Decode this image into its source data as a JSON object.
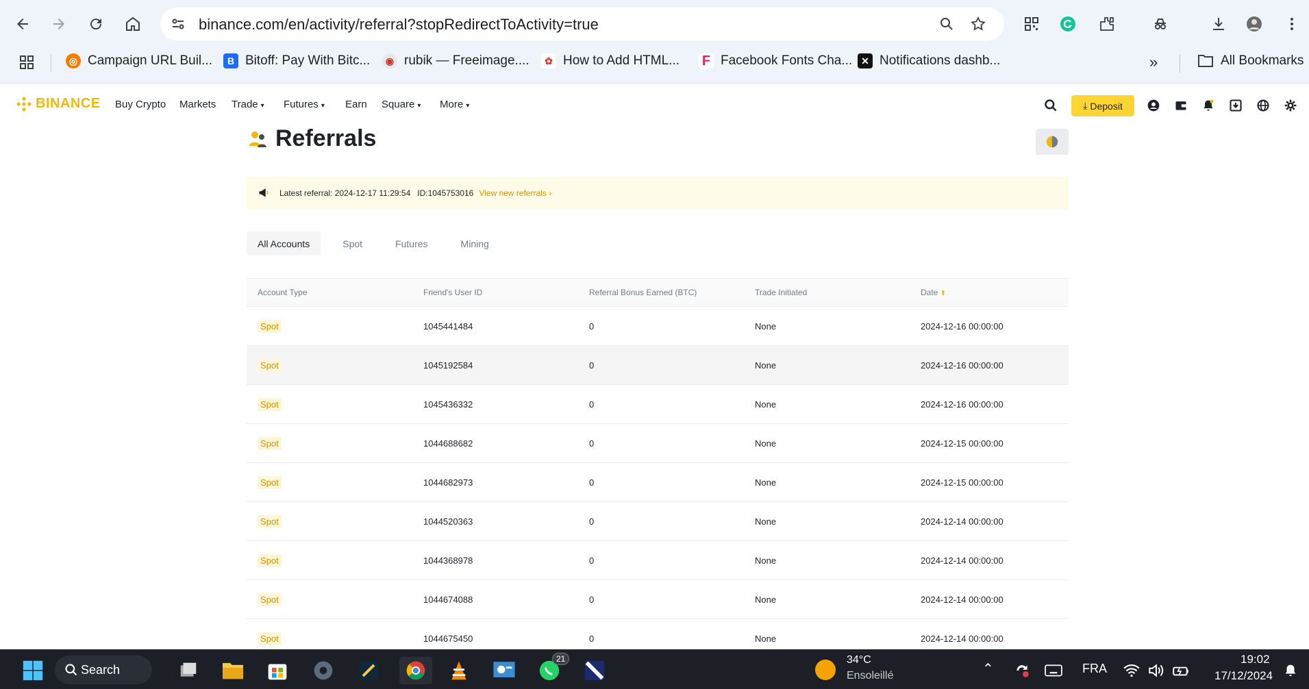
{
  "browser": {
    "url": "binance.com/en/activity/referral?stopRedirectToActivity=true",
    "bookmarks": [
      {
        "label": "Campaign URL Buil...",
        "color": "#f57c00"
      },
      {
        "label": "Bitoff: Pay With Bitc...",
        "color": "#1e6cf5"
      },
      {
        "label": "rubik — Freeimage....",
        "color": "#c8c8c8"
      },
      {
        "label": "How to Add HTML...",
        "color": "#e53935"
      },
      {
        "label": "Facebook Fonts Cha...",
        "color": "#e91e63"
      },
      {
        "label": "Notifications dashb...",
        "color": "#111111"
      }
    ],
    "all_bookmarks": "All Bookmarks"
  },
  "header": {
    "brand": "BINANCE",
    "nav": [
      "Buy Crypto",
      "Markets",
      "Trade",
      "Futures",
      "Earn",
      "Square",
      "More"
    ],
    "deposit": "Deposit"
  },
  "page": {
    "title": "Referrals",
    "notice": {
      "text": "Latest referral: 2024-12-17 11:29:54   ID:1045753016",
      "link": "View new referrals ›"
    },
    "tabs": [
      "All Accounts",
      "Spot",
      "Futures",
      "Mining"
    ],
    "table": {
      "columns": [
        "Account Type",
        "Friend's User ID",
        "Referral Bonus Earned (BTC)",
        "Trade Initiated",
        "Date"
      ],
      "rows": [
        [
          "Spot",
          "1045441484",
          "0",
          "None",
          "2024-12-16 00:00:00"
        ],
        [
          "Spot",
          "1045192584",
          "0",
          "None",
          "2024-12-16 00:00:00"
        ],
        [
          "Spot",
          "1045436332",
          "0",
          "None",
          "2024-12-16 00:00:00"
        ],
        [
          "Spot",
          "1044688682",
          "0",
          "None",
          "2024-12-15 00:00:00"
        ],
        [
          "Spot",
          "1044682973",
          "0",
          "None",
          "2024-12-15 00:00:00"
        ],
        [
          "Spot",
          "1044520363",
          "0",
          "None",
          "2024-12-14 00:00:00"
        ],
        [
          "Spot",
          "1044368978",
          "0",
          "None",
          "2024-12-14 00:00:00"
        ],
        [
          "Spot",
          "1044674088",
          "0",
          "None",
          "2024-12-14 00:00:00"
        ],
        [
          "Spot",
          "1044675450",
          "0",
          "None",
          "2024-12-14 00:00:00"
        ]
      ]
    }
  },
  "taskbar": {
    "search": "Search",
    "whatsapp_badge": "21",
    "weather_temp": "34°C",
    "weather_desc": "Ensoleillé",
    "lang": "FRA",
    "time": "19:02",
    "date": "17/12/2024"
  },
  "colors": {
    "brand": "#f0b90b",
    "deposit": "#fcd535",
    "badge_text": "#c99400"
  }
}
